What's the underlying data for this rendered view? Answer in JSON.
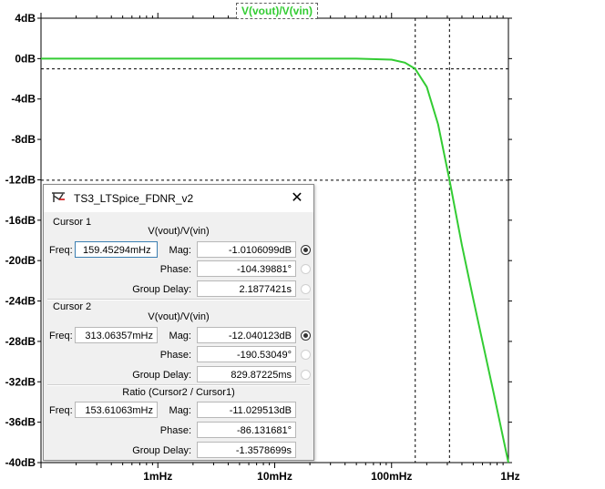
{
  "plot": {
    "trace_title": "V(vout)/V(vin)",
    "y_ticks": [
      "4dB",
      "0dB",
      "-4dB",
      "-8dB",
      "-12dB",
      "-16dB",
      "-20dB",
      "-24dB",
      "-28dB",
      "-32dB",
      "-36dB",
      "-40dB"
    ],
    "x_ticks": [
      "1mHz",
      "10mHz",
      "100mHz",
      "1Hz"
    ],
    "trace_color": "#33cc33"
  },
  "chart_data": {
    "type": "line",
    "title": "V(vout)/V(vin)",
    "xlabel": "",
    "ylabel": "",
    "x_scale": "log",
    "xlim": [
      "100µHz",
      "1Hz"
    ],
    "ylim": [
      -40,
      4
    ],
    "grid": false,
    "series": [
      {
        "name": "V(vout)/V(vin)",
        "x_hz": [
          0.0001,
          0.001,
          0.01,
          0.05,
          0.1,
          0.13,
          0.159,
          0.2,
          0.25,
          0.313,
          0.4,
          0.5,
          0.6,
          0.75,
          0.9,
          1.0
        ],
        "y_db": [
          0,
          0,
          0,
          0,
          -0.1,
          -0.4,
          -1.0,
          -2.8,
          -6.5,
          -12.0,
          -18.5,
          -23.8,
          -28.0,
          -33.2,
          -37.5,
          -40
        ]
      }
    ],
    "cursors": [
      {
        "freq_hz": 0.15945294,
        "mag_db": -1.0106099
      },
      {
        "freq_hz": 0.31306357,
        "mag_db": -12.040123
      }
    ]
  },
  "dialog": {
    "title": "TS3_LTSpice_FDNR_v2",
    "close": "✕",
    "cursor1": {
      "header": "Cursor 1",
      "expr": "V(vout)/V(vin)",
      "freq_label": "Freq:",
      "freq": "159.45294mHz",
      "mag_label": "Mag:",
      "mag": "-1.0106099dB",
      "phase_label": "Phase:",
      "phase": "-104.39881°",
      "gd_label": "Group Delay:",
      "gd": "2.1877421s"
    },
    "cursor2": {
      "header": "Cursor 2",
      "expr": "V(vout)/V(vin)",
      "freq_label": "Freq:",
      "freq": "313.06357mHz",
      "mag_label": "Mag:",
      "mag": "-12.040123dB",
      "phase_label": "Phase:",
      "phase": "-190.53049°",
      "gd_label": "Group Delay:",
      "gd": "829.87225ms"
    },
    "ratio": {
      "header": "Ratio (Cursor2 / Cursor1)",
      "freq_label": "Freq:",
      "freq": "153.61063mHz",
      "mag_label": "Mag:",
      "mag": "-11.029513dB",
      "phase_label": "Phase:",
      "phase": "-86.131681°",
      "gd_label": "Group Delay:",
      "gd": "-1.3578699s"
    }
  }
}
